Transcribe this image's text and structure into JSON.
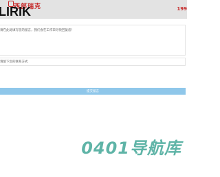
{
  "header": {
    "logo_cn": "西部瑞克",
    "logo_en": "LIRIK",
    "right_text": "199"
  },
  "form": {
    "message_placeholder": "请在此处填写您的留言，我们会在工作日尽快回复您！",
    "contact_placeholder": "请留下您的联系方式",
    "submit_label": "提交留言"
  },
  "watermark": "0401导航库"
}
